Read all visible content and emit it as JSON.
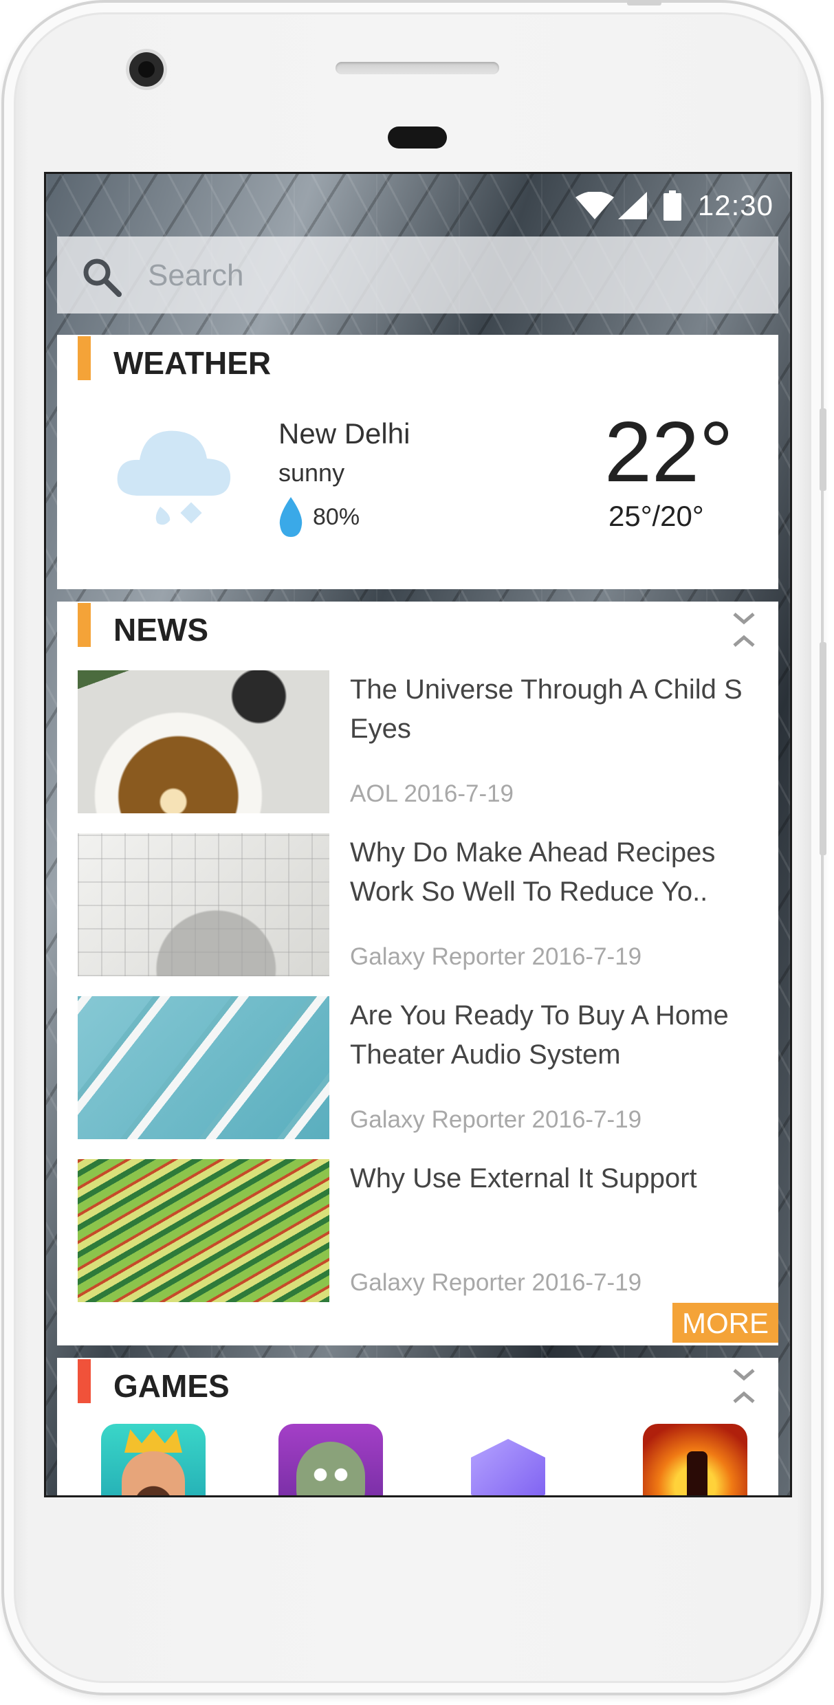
{
  "status_bar": {
    "time": "12:30",
    "icons": [
      "wifi-icon",
      "cellular-signal-icon",
      "battery-icon"
    ]
  },
  "search": {
    "placeholder": "Search",
    "icon": "search-icon"
  },
  "weather": {
    "title": "WEATHER",
    "accent_color": "#f4a338",
    "icon": "cloud-rain-icon",
    "city": "New Delhi",
    "condition": "sunny",
    "humidity": "80%",
    "temperature": "22°",
    "high_low": "25°/20°"
  },
  "news": {
    "title": "NEWS",
    "accent_color": "#f4a338",
    "items": [
      {
        "headline": "The Universe Through A Child S Eyes",
        "source": "AOL 2016-7-19"
      },
      {
        "headline": "Why Do Make Ahead Recipes Work So Well To Reduce Yo..",
        "source": "Galaxy Reporter 2016-7-19"
      },
      {
        "headline": "Are You Ready To Buy A Home Theater Audio System",
        "source": "Galaxy Reporter 2016-7-19"
      },
      {
        "headline": "Why Use External It Support",
        "source": "Galaxy Reporter 2016-7-19"
      }
    ],
    "more_label": "MORE"
  },
  "games": {
    "title": "GAMES",
    "accent_color": "#f0523a",
    "icons": [
      "clash-royale-icon",
      "plants-vs-zombies-icon",
      "cube-game-icon",
      "shadow-fight-icon"
    ]
  }
}
